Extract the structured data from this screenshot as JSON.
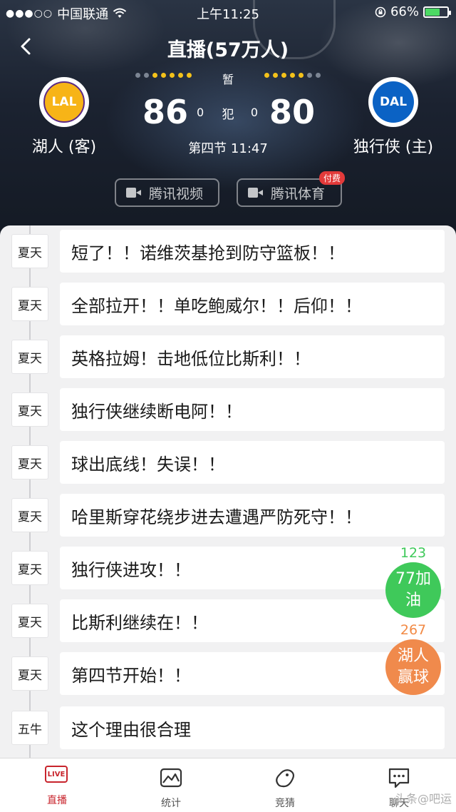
{
  "status_bar": {
    "carrier": "中国联通",
    "time": "上午11:25",
    "battery_percent": "66%",
    "battery_level": 0.66
  },
  "nav": {
    "title": "直播(57万人)"
  },
  "game": {
    "away": {
      "abbr": "LAL",
      "name": "湖人 (客)",
      "score": "86",
      "fouls": "0"
    },
    "home": {
      "abbr": "DAL",
      "name": "独行侠 (主)",
      "score": "80",
      "fouls": "0"
    },
    "timeout_label": "暂",
    "foul_label": "犯",
    "period": "第四节 11:47"
  },
  "sources": [
    {
      "label": "腾讯视频"
    },
    {
      "label": "腾讯体育",
      "badge": "付费"
    }
  ],
  "feed": [
    {
      "author": "夏天",
      "text": "短了！！诺维茨基抢到防守篮板！！"
    },
    {
      "author": "夏天",
      "text": "全部拉开！！单吃鲍威尔！！后仰！！"
    },
    {
      "author": "夏天",
      "text": "英格拉姆！击地低位比斯利！！"
    },
    {
      "author": "夏天",
      "text": "独行侠继续断电阿！！"
    },
    {
      "author": "夏天",
      "text": "球出底线！失误！！"
    },
    {
      "author": "夏天",
      "text": "哈里斯穿花绕步进去遭遇严防死守！！"
    },
    {
      "author": "夏天",
      "text": "独行侠进攻！！"
    },
    {
      "author": "夏天",
      "text": "比斯利继续在！！"
    },
    {
      "author": "夏天",
      "text": "第四节开始！！"
    },
    {
      "author": "五牛",
      "text": "这个理由很合理"
    }
  ],
  "votes": {
    "green": {
      "count": "123",
      "line1": "77加",
      "line2": "油",
      "color": "#3fc95a"
    },
    "orange": {
      "count": "267",
      "line1": "湖人",
      "line2": "赢球",
      "color": "#f08a4c"
    }
  },
  "tabs": [
    {
      "label": "直播",
      "icon": "live-icon",
      "active": true
    },
    {
      "label": "统计",
      "icon": "stats-icon"
    },
    {
      "label": "竞猜",
      "icon": "guess-icon"
    },
    {
      "label": "聊天",
      "icon": "chat-icon"
    }
  ],
  "watermark": "头条@吧运",
  "colors": {
    "accent_red": "#c8242c",
    "gold_dot": "#f4c21a",
    "lal_gold": "#f7b417",
    "dal_blue": "#0b62c4"
  }
}
